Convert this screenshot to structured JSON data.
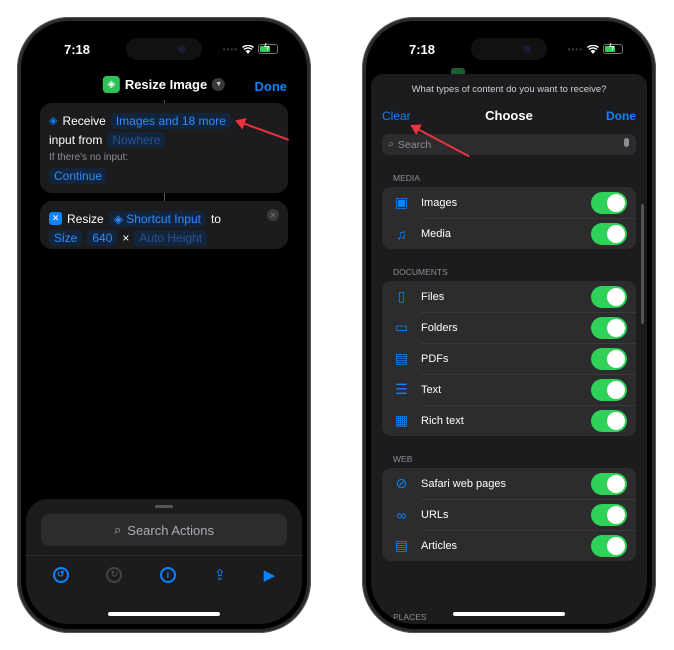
{
  "left": {
    "status": {
      "time": "7:18"
    },
    "nav": {
      "title": "Resize Image",
      "done": "Done"
    },
    "receive_card": {
      "verb": "Receive",
      "types": "Images and 18 more",
      "input_from_label": "input from",
      "source": "Nowhere",
      "no_input_label": "If there's no input:",
      "no_input_action": "Continue"
    },
    "resize_card": {
      "verb": "Resize",
      "input": "Shortcut Input",
      "to": "to",
      "mode": "Size",
      "width": "640",
      "times": "×",
      "height": "Auto Height"
    },
    "search_actions": "Search Actions",
    "toolbar": [
      "undo",
      "redo",
      "info",
      "share",
      "play"
    ]
  },
  "right": {
    "status": {
      "time": "7:18"
    },
    "question": "What types of content do you want to receive?",
    "nav": {
      "clear": "Clear",
      "title": "Choose",
      "done": "Done"
    },
    "search_placeholder": "Search",
    "sections": [
      {
        "title": "MEDIA",
        "items": [
          {
            "icon": "photo-icon",
            "glyph": "▣",
            "label": "Images",
            "on": true
          },
          {
            "icon": "music-icon",
            "glyph": "♫",
            "label": "Media",
            "on": true
          }
        ]
      },
      {
        "title": "DOCUMENTS",
        "items": [
          {
            "icon": "file-icon",
            "glyph": "▯",
            "label": "Files",
            "on": true
          },
          {
            "icon": "folder-icon",
            "glyph": "▭",
            "label": "Folders",
            "on": true
          },
          {
            "icon": "pdf-icon",
            "glyph": "▤",
            "label": "PDFs",
            "on": true
          },
          {
            "icon": "text-icon",
            "glyph": "☰",
            "label": "Text",
            "on": true
          },
          {
            "icon": "rich-text-icon",
            "glyph": "▦",
            "label": "Rich text",
            "on": true
          }
        ]
      },
      {
        "title": "WEB",
        "items": [
          {
            "icon": "compass-icon",
            "glyph": "⊘",
            "label": "Safari web pages",
            "on": true
          },
          {
            "icon": "link-icon",
            "glyph": "∞",
            "label": "URLs",
            "on": true
          },
          {
            "icon": "article-icon",
            "glyph": "▤",
            "label": "Articles",
            "on": true
          }
        ]
      }
    ],
    "next_section": "PLACES"
  },
  "colors": {
    "accent": "#0a84ff",
    "toggle_on": "#30d158",
    "arrow": "#e8343f"
  }
}
